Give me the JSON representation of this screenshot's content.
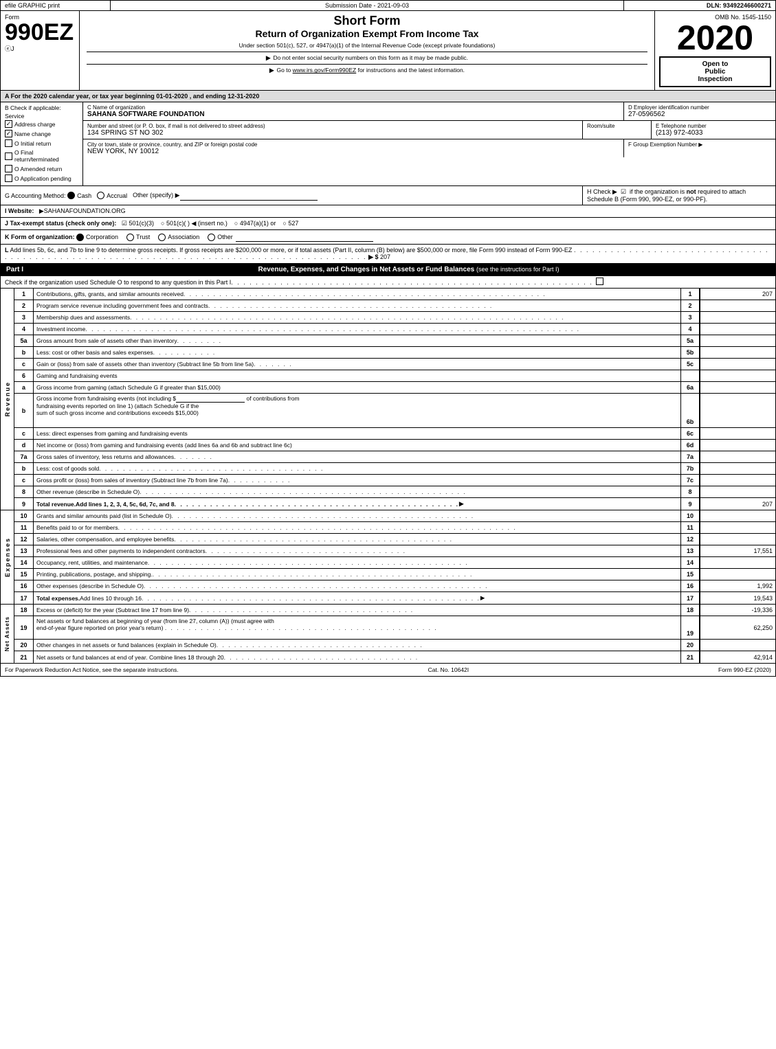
{
  "topBar": {
    "efile": "efile GRAPHIC print",
    "submission": "Submission Date - 2021-09-03",
    "dln": "DLN: 93492246600271"
  },
  "header": {
    "formLabel": "Form",
    "formNumber": "990EZ",
    "formSub": "ⓔJ",
    "shortFormTitle": "Short Form",
    "returnTitle": "Return of Organization Exempt From Income Tax",
    "underSection": "Under section 501(c), 527, or 4947(a)(1) of the Internal Revenue Code (except private foundations)",
    "noSSN": "▶ Do not enter social security numbers on this form as it may be made public.",
    "irsLink": "▶ Go to www.irs.gov/Form990EZ for instructions and the latest information.",
    "ombNo": "OMB No. 1545-1150",
    "year": "2020",
    "openToPublic": "Open to Public Inspection"
  },
  "taxYear": {
    "text": "A For the 2020 calendar year, or tax year beginning 01-01-2020 , and ending 12-31-2020"
  },
  "checkIfApplicable": {
    "label": "B Check if applicable:",
    "addressChange": {
      "label": "Address charge",
      "checked": true
    },
    "nameChange": {
      "label": "Name change",
      "checked": true
    },
    "initialReturn": {
      "label": "O Initial return",
      "checked": false
    },
    "finalReturn": {
      "label": "O Final return/terminated",
      "checked": false
    },
    "amendedReturn": {
      "label": "O Amended return",
      "checked": false
    },
    "applicationPending": {
      "label": "O Application pending",
      "checked": false
    }
  },
  "orgInfo": {
    "cLabel": "C Name of organization",
    "orgName": "SAHANA SOFTWARE FOUNDATION",
    "dLabel": "D Employer identification number",
    "ein": "27-0596562",
    "addressLabel": "Number and street (or P. O. box, if mail is not delivered to street address)",
    "address": "134 SPRING ST NO 302",
    "roomSuite": "Room/suite",
    "eLabel": "E Telephone number",
    "phone": "(213) 972-4033",
    "cityLabel": "City or town, state or province, country, and ZIP or foreign postal code",
    "city": "NEW YORK, NY  10012",
    "fLabel": "F Group Exemption Number",
    "fArrow": "▶"
  },
  "accounting": {
    "gLabel": "G Accounting Method:",
    "cashLabel": "Cash",
    "accrualLabel": "Accrual",
    "otherLabel": "Other (specify) ▶",
    "cashChecked": true,
    "accrualChecked": false,
    "hLabel": "H  Check ▶",
    "hText": "☑ if the organization is not required to attach Schedule B (Form 990, 990-EZ, or 990-PF)."
  },
  "website": {
    "iLabel": "I Website:",
    "arrowLabel": "▶SAHANAFOUNDATION.ORG"
  },
  "taxStatus": {
    "jLabel": "J Tax-exempt status (check only one):",
    "options": [
      "☑ 501(c)(3)",
      "○ 501(c)(  ) ◀ (insert no.)",
      "○ 4947(a)(1) or",
      "○ 527"
    ]
  },
  "formOrg": {
    "kLabel": "K Form of organization:",
    "corporation": {
      "label": "Corporation",
      "checked": true
    },
    "trust": {
      "label": "Trust",
      "checked": false
    },
    "association": {
      "label": "Association",
      "checked": false
    },
    "other": {
      "label": "Other",
      "checked": false
    }
  },
  "lineL": {
    "text": "L Add lines 5b, 6c, and 7b to line 9 to determine gross receipts. If gross receipts are $200,000 or more, or if total assets (Part II, column (B) below) are $500,000 or more, file Form 990 instead of Form 990-EZ",
    "dots": " . . . . . . . . . . . . . . . . . . . . . . . . . . . . . . . . . . . . . . . . . . . . . . . . . . . . . . . . . . . . . . . . . . . . . . . . . . . . . . . . . . . . . . . . . . . . .",
    "arrow": "▶ $",
    "value": "207"
  },
  "partI": {
    "label": "Part I",
    "title": "Revenue, Expenses, and Changes in Net Assets or Fund Balances",
    "seeInstructions": "(see the instructions for Part I)",
    "checkRow": "Check if the organization used Schedule O to respond to any question in this Part I",
    "checkDots": " . . . . . . . . . . . . . . . . . . . . . . . . . . . . . . . . . . . . . . . . . . . . . . . . . . . . . . . . . ."
  },
  "revenueRows": [
    {
      "num": "1",
      "sub": "",
      "desc": "Contributions, gifts, grants, and similar amounts received",
      "ref": "1",
      "amount": "207",
      "bold": false
    },
    {
      "num": "2",
      "sub": "",
      "desc": "Program service revenue including government fees and contracts",
      "ref": "2",
      "amount": "",
      "bold": false
    },
    {
      "num": "3",
      "sub": "",
      "desc": "Membership dues and assessments",
      "ref": "3",
      "amount": "",
      "bold": false
    },
    {
      "num": "4",
      "sub": "",
      "desc": "Investment income",
      "ref": "4",
      "amount": "",
      "bold": false
    },
    {
      "num": "5a",
      "sub": "",
      "desc": "Gross amount from sale of assets other than inventory",
      "ref": "5a",
      "amount": "",
      "bold": false
    },
    {
      "num": "b",
      "sub": "",
      "desc": "Less: cost or other basis and sales expenses",
      "ref": "5b",
      "amount": "",
      "bold": false
    },
    {
      "num": "c",
      "sub": "",
      "desc": "Gain or (loss) from sale of assets other than inventory (Subtract line 5b from line 5a)",
      "ref": "5c",
      "amount": "",
      "bold": false
    },
    {
      "num": "6",
      "sub": "",
      "desc": "Gaming and fundraising events",
      "ref": "",
      "amount": "",
      "bold": false,
      "noref": true
    },
    {
      "num": "a",
      "sub": "",
      "desc": "Gross income from gaming (attach Schedule G if greater than $15,000)",
      "ref": "6a",
      "amount": "",
      "bold": false
    },
    {
      "num": "b",
      "sub": "",
      "desc": "Gross income from fundraising events (not including $_____________ of contributions from fundraising events reported on line 1) (attach Schedule G if the sum of such gross income and contributions exceeds $15,000)",
      "ref": "6b",
      "amount": "",
      "bold": false,
      "multiline": true
    },
    {
      "num": "c",
      "sub": "",
      "desc": "Less: direct expenses from gaming and fundraising events",
      "ref": "6c",
      "amount": "",
      "bold": false
    },
    {
      "num": "d",
      "sub": "",
      "desc": "Net income or (loss) from gaming and fundraising events (add lines 6a and 6b and subtract line 6c)",
      "ref": "6d",
      "amount": "",
      "bold": false
    },
    {
      "num": "7a",
      "sub": "",
      "desc": "Gross sales of inventory, less returns and allowances",
      "ref": "7a",
      "amount": "",
      "bold": false
    },
    {
      "num": "b",
      "sub": "",
      "desc": "Less: cost of goods sold",
      "ref": "7b",
      "amount": "",
      "bold": false
    },
    {
      "num": "c",
      "sub": "",
      "desc": "Gross profit or (loss) from sales of inventory (Subtract line 7b from line 7a)",
      "ref": "7c",
      "amount": "",
      "bold": false
    },
    {
      "num": "8",
      "sub": "",
      "desc": "Other revenue (describe in Schedule O)",
      "ref": "8",
      "amount": "",
      "bold": false
    },
    {
      "num": "9",
      "sub": "",
      "desc": "Total revenue. Add lines 1, 2, 3, 4, 5c, 6d, 7c, and 8",
      "ref": "9",
      "amount": "207",
      "bold": true,
      "arrow": true
    }
  ],
  "expenseRows": [
    {
      "num": "10",
      "desc": "Grants and similar amounts paid (list in Schedule O)",
      "ref": "10",
      "amount": ""
    },
    {
      "num": "11",
      "desc": "Benefits paid to or for members",
      "ref": "11",
      "amount": ""
    },
    {
      "num": "12",
      "desc": "Salaries, other compensation, and employee benefits",
      "ref": "12",
      "amount": ""
    },
    {
      "num": "13",
      "desc": "Professional fees and other payments to independent contractors",
      "ref": "13",
      "amount": "17,551"
    },
    {
      "num": "14",
      "desc": "Occupancy, rent, utilities, and maintenance",
      "ref": "14",
      "amount": ""
    },
    {
      "num": "15",
      "desc": "Printing, publications, postage, and shipping.",
      "ref": "15",
      "amount": ""
    },
    {
      "num": "16",
      "desc": "Other expenses (describe in Schedule O)",
      "ref": "16",
      "amount": "1,992"
    },
    {
      "num": "17",
      "desc": "Total expenses. Add lines 10 through 16",
      "ref": "17",
      "amount": "19,543",
      "bold": true,
      "arrow": true
    }
  ],
  "netAssetsRows": [
    {
      "num": "18",
      "desc": "Excess or (deficit) for the year (Subtract line 17 from line 9)",
      "ref": "18",
      "amount": "-19,336"
    },
    {
      "num": "19",
      "desc": "Net assets or fund balances at beginning of year (from line 27, column (A)) (must agree with end-of-year figure reported on prior year's return)",
      "ref": "19",
      "amount": "62,250",
      "multiline": true
    },
    {
      "num": "20",
      "desc": "Other changes in net assets or fund balances (explain in Schedule O)",
      "ref": "20",
      "amount": ""
    },
    {
      "num": "21",
      "desc": "Net assets or fund balances at end of year. Combine lines 18 through 20",
      "ref": "21",
      "amount": "42,914",
      "bold": true
    }
  ],
  "footer": {
    "left": "For Paperwork Reduction Act Notice, see the separate instructions.",
    "center": "Cat. No. 10642I",
    "right": "Form 990-EZ (2020)"
  }
}
